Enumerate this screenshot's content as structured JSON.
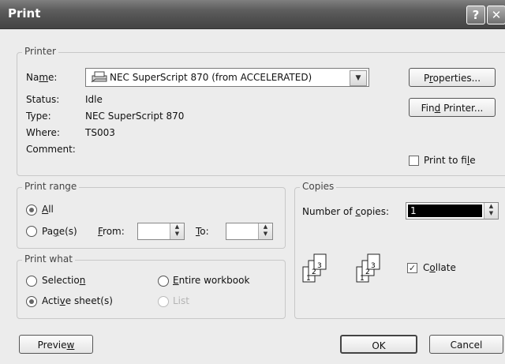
{
  "window": {
    "title": "Print",
    "help_glyph": "?",
    "close_glyph": "✕"
  },
  "printer": {
    "group_title": "Printer",
    "name_label": "Name:",
    "name_value": "NEC SuperScript 870 (from ACCELERATED)",
    "status_label": "Status:",
    "status_value": "Idle",
    "type_label": "Type:",
    "type_value": "NEC SuperScript 870",
    "where_label": "Where:",
    "where_value": "TS003",
    "comment_label": "Comment:",
    "properties_button": "Properties...",
    "find_button": "Find Printer...",
    "print_to_file_label": "Print to file",
    "print_to_file_checked": false
  },
  "print_range": {
    "group_title": "Print range",
    "all_label": "All",
    "pages_label": "Page(s)",
    "from_label": "From:",
    "from_value": "",
    "to_label": "To:",
    "to_value": "",
    "selected": "All"
  },
  "print_what": {
    "group_title": "Print what",
    "selection_label": "Selection",
    "entire_workbook_label": "Entire workbook",
    "active_sheets_label": "Active sheet(s)",
    "list_label": "List",
    "selected": "Active sheet(s)"
  },
  "copies": {
    "group_title": "Copies",
    "number_label": "Number of copies:",
    "number_value": "1",
    "collate_label": "Collate",
    "collate_checked": true,
    "uncollated_pages": [
      "1",
      "2",
      "3"
    ],
    "collated_pages": [
      "1",
      "2",
      "3"
    ]
  },
  "footer": {
    "preview_button": "Preview",
    "ok_button": "OK",
    "cancel_button": "Cancel"
  }
}
